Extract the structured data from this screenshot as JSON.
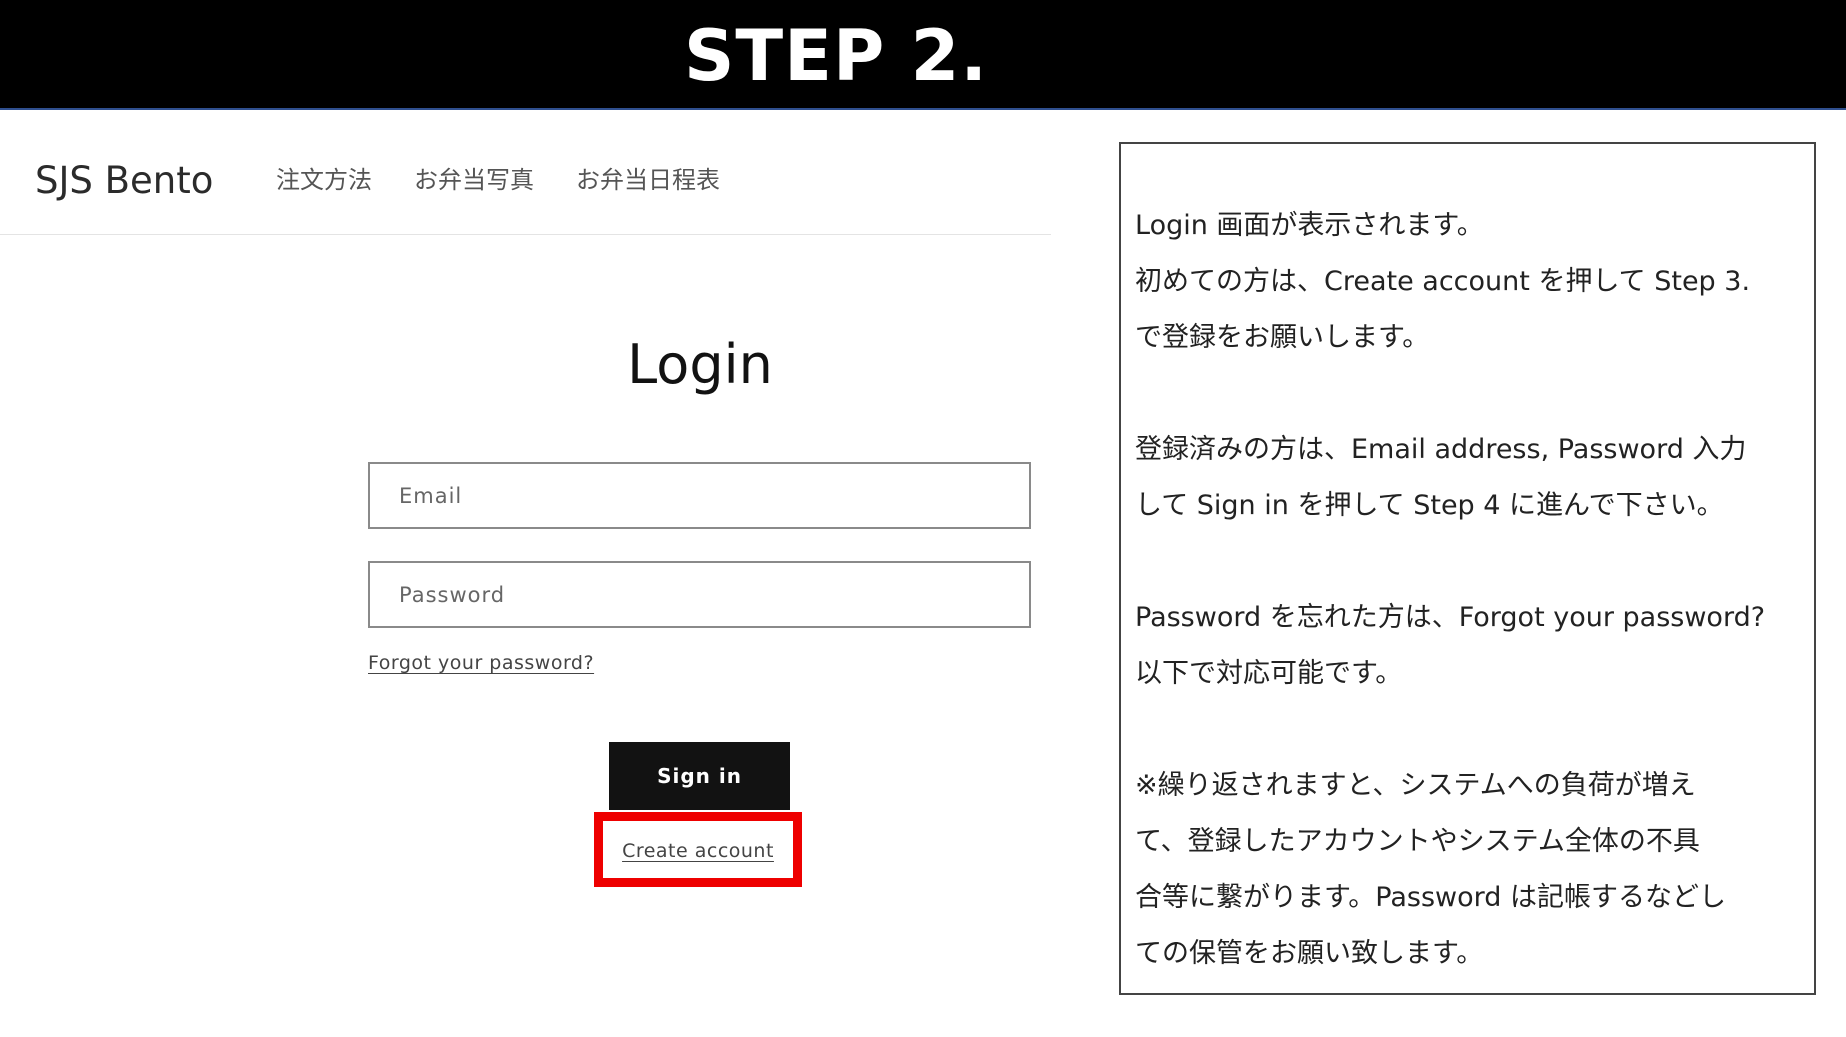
{
  "banner": {
    "title": "STEP 2."
  },
  "header": {
    "brand": "SJS Bento",
    "nav": [
      {
        "label": "注文方法"
      },
      {
        "label": "お弁当写真"
      },
      {
        "label": "お弁当日程表"
      }
    ]
  },
  "login": {
    "title": "Login",
    "email_placeholder": "Email",
    "password_placeholder": "Password",
    "forgot_label": "Forgot your password?",
    "signin_label": "Sign in",
    "create_label": "Create account"
  },
  "instructions": {
    "paragraphs": [
      "Login 画面が表示されます。\n初めての方は、Create account を押して Step 3.\nで登録をお願いします。",
      "登録済みの方は、Email address, Password 入力\nして Sign in を押して Step 4 に進んで下さい。",
      "Password を忘れた方は、Forgot your password?\n以下で対応可能です。",
      "※繰り返されますと、システムへの負荷が増え\nて、登録したアカウントやシステム全体の不具\n合等に繋がります。Password は記帳するなどし\nての保管をお願い致します。"
    ]
  },
  "colors": {
    "banner_bg": "#000000",
    "highlight": "#ee0000",
    "button_bg": "#121212"
  }
}
